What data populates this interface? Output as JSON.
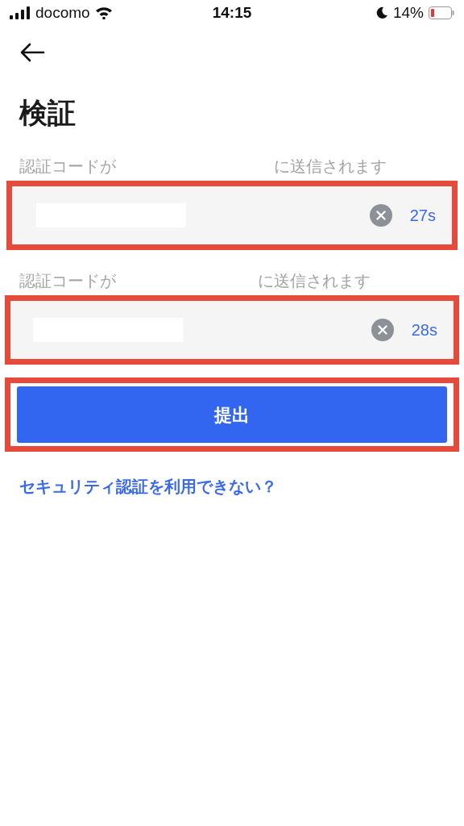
{
  "status_bar": {
    "carrier": "docomo",
    "time": "14:15",
    "battery": "14%"
  },
  "title": "検証",
  "code_fields": [
    {
      "label_start": "認証コードが",
      "label_end": "に送信されます",
      "timer": "27s",
      "highlighted": true
    },
    {
      "label_start": "認証コードが",
      "label_end": "に送信されます",
      "timer": "28s",
      "highlighted": true
    }
  ],
  "submit": {
    "label": "提出",
    "highlighted": true
  },
  "help_link": "セキュリティ認証を利用できない？"
}
